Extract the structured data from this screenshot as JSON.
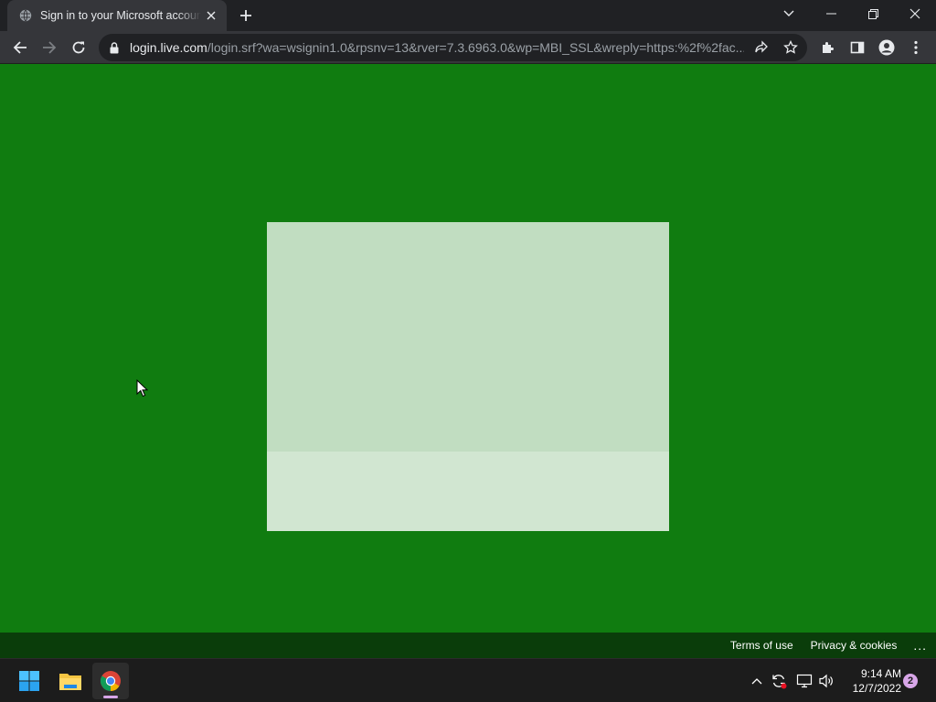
{
  "browser": {
    "tab": {
      "title": "Sign in to your Microsoft account",
      "favicon": "globe-icon"
    },
    "new_tab_icon": "plus-icon",
    "window_controls": [
      "tab-search-icon",
      "minimize-icon",
      "restore-icon",
      "close-icon"
    ],
    "toolbar": {
      "back_icon": "back-arrow-icon",
      "forward_icon": "forward-arrow-icon",
      "reload_icon": "reload-icon",
      "url_host": "login.live.com",
      "url_rest": "/login.srf?wa=wsignin1.0&rpsnv=13&rver=7.3.6963.0&wp=MBI_SSL&wreply=https:%2f%2fac...",
      "omnibox_icons": [
        "share-icon",
        "star-icon"
      ],
      "extension_icons": [
        "puzzle-icon",
        "side-panel-icon",
        "profile-icon",
        "menu-icon"
      ]
    }
  },
  "page": {
    "background_color": "#107c10",
    "card_top_color": "#c1ddc1",
    "card_bottom_color": "#d1e6d1",
    "footer": {
      "terms": "Terms of use",
      "privacy": "Privacy & cookies",
      "more": "..."
    }
  },
  "taskbar": {
    "apps": [
      "windows-start-icon",
      "file-explorer-icon",
      "chrome-icon"
    ],
    "tray_icons": [
      "chevron-up-icon",
      "sync-icon",
      "display-icon",
      "volume-icon"
    ],
    "time": "9:14 AM",
    "date": "12/7/2022",
    "notification_count": "2"
  }
}
